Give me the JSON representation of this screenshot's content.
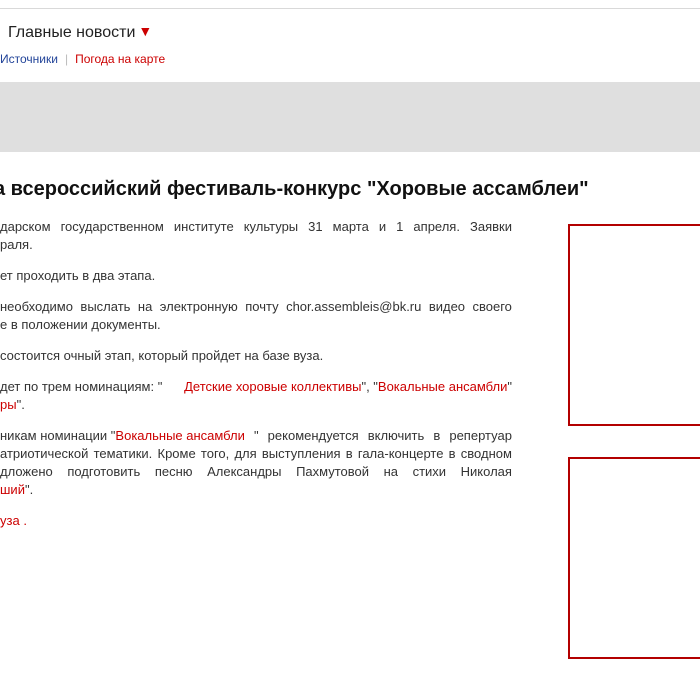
{
  "header": {
    "title": "Главные новости",
    "caret": "▼"
  },
  "subnav": {
    "sources": "Источники",
    "separator": "|",
    "weather_map": "Погода на карте"
  },
  "article": {
    "title": "а всероссийский фестиваль-конкурс \"Хоровые ассамблеи\"",
    "p1": {
      "line1_words": [
        "дарском",
        "государственном",
        "институте",
        "культуры",
        "31",
        "марта",
        "и",
        "1",
        "апреля.",
        "Заявки"
      ],
      "line2": "раля."
    },
    "p2": "ет проходить в два этапа.",
    "p3": {
      "line1_words": [
        "необходимо",
        "выслать",
        "на",
        "электронную",
        "почту",
        "chor.assembleis@bk.ru",
        "видео",
        "своего"
      ],
      "line2": "е в положении документы."
    },
    "p4": "состоится очный этап, который пройдет на базе вуза.",
    "p5": {
      "prefix": "дет по трем номинациям: \"",
      "link1": "Детские хоровые коллективы",
      "mid": "\", \"",
      "link2": "Вокальные ансамбли",
      "suffix": "\"",
      "line2_link": "ры",
      "line2_suffix": "\"."
    },
    "p6": {
      "line1_prefix": "никам номинации \"",
      "line1_link": "Вокальные ансамбли",
      "line1_suffix_words": [
        "\"",
        "рекомендуется",
        "включить",
        "в",
        "репертуар"
      ],
      "line2_words": [
        "атриотической",
        "тематики.",
        "Кроме",
        "того,",
        "для",
        "выступления",
        "в",
        "гала-концерте",
        "в",
        "сводном"
      ],
      "line3_words": [
        "дложено",
        "подготовить",
        "песню",
        "Александры",
        "Пахмутовой",
        "на",
        "стихи",
        "Николая"
      ],
      "line4_link": "ший",
      "line4_suffix": "\"."
    },
    "p7": {
      "link": "уза",
      "suffix": " ."
    }
  },
  "colors": {
    "accent_red": "#cc0000",
    "link_blue": "#224499",
    "banner_gray": "#dfdfdf",
    "ad_border": "#b30000"
  }
}
